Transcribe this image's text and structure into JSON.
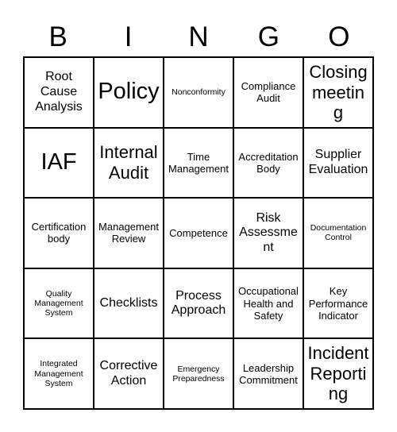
{
  "card": {
    "header_letters": [
      "B",
      "I",
      "N",
      "G",
      "O"
    ],
    "rows": [
      [
        {
          "text": "Root Cause Analysis",
          "size": "md"
        },
        {
          "text": "Policy",
          "size": "xl"
        },
        {
          "text": "Nonconformity",
          "size": "xs"
        },
        {
          "text": "Compliance Audit",
          "size": "sm"
        },
        {
          "text": "Closing meeting",
          "size": "lg"
        }
      ],
      [
        {
          "text": "IAF",
          "size": "xl"
        },
        {
          "text": "Internal Audit",
          "size": "lg"
        },
        {
          "text": "Time Management",
          "size": "sm"
        },
        {
          "text": "Accreditation Body",
          "size": "sm"
        },
        {
          "text": "Supplier Evaluation",
          "size": "md"
        }
      ],
      [
        {
          "text": "Certification body",
          "size": "sm"
        },
        {
          "text": "Management Review",
          "size": "sm"
        },
        {
          "text": "Competence",
          "size": "sm"
        },
        {
          "text": "Risk Assessment",
          "size": "md"
        },
        {
          "text": "Documentation Control",
          "size": "xs"
        }
      ],
      [
        {
          "text": "Quality Management System",
          "size": "xs"
        },
        {
          "text": "Checklists",
          "size": "md"
        },
        {
          "text": "Process Approach",
          "size": "md"
        },
        {
          "text": "Occupational Health and Safety",
          "size": "sm"
        },
        {
          "text": "Key Performance Indicator",
          "size": "sm"
        }
      ],
      [
        {
          "text": "Integrated Management System",
          "size": "xs"
        },
        {
          "text": "Corrective Action",
          "size": "md"
        },
        {
          "text": "Emergency Preparedness",
          "size": "xs"
        },
        {
          "text": "Leadership Commitment",
          "size": "sm"
        },
        {
          "text": "Incident Reporting",
          "size": "lg"
        }
      ]
    ]
  }
}
